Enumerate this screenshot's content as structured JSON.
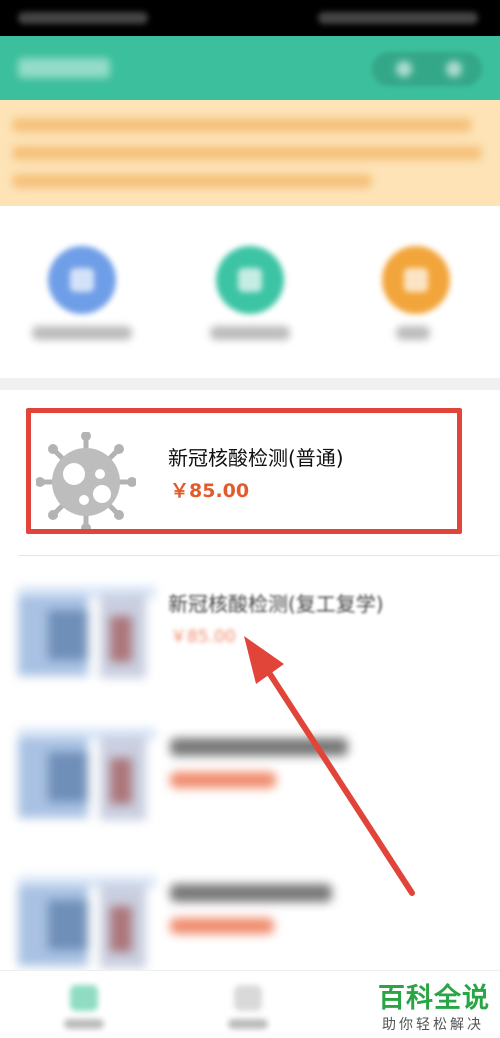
{
  "products": [
    {
      "title": "新冠核酸检测(普通)",
      "price": "￥85.00",
      "image": "virus-icon"
    },
    {
      "title": "新冠核酸检测(复工复学)",
      "price": "￥85.00",
      "image": "product-thumbnail"
    },
    {
      "title": "",
      "price": "",
      "image": "product-thumbnail"
    },
    {
      "title": "",
      "price": "",
      "image": "product-thumbnail"
    }
  ],
  "quick_menu": [
    {
      "icon": "calendar-icon",
      "color": "#6f9ee8"
    },
    {
      "icon": "report-icon",
      "color": "#3cc4a4"
    },
    {
      "icon": "card-icon",
      "color": "#f2a53a"
    }
  ],
  "watermark": {
    "title": "百科全说",
    "subtitle": "助你轻松解决"
  },
  "colors": {
    "header": "#3cbf9c",
    "notice_bg": "#fde3b6",
    "price": "#e25b2c",
    "highlight": "#e1453a",
    "arrow": "#e1453a",
    "watermark": "#2aa545"
  }
}
